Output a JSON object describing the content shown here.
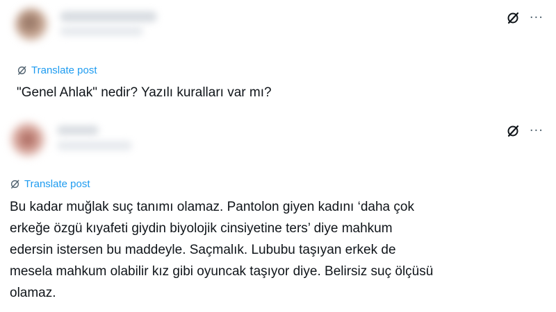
{
  "posts": [
    {
      "avatar_colors": [
        "#8a6a5a",
        "#c9a894"
      ],
      "translate_label": "Translate post",
      "text": "\"Genel Ahlak\" nedir? Yazılı kuralları var mı?",
      "more_label": "···"
    },
    {
      "avatar_colors": [
        "#a05a50",
        "#e8c8c0"
      ],
      "translate_label": "Translate post",
      "text": "Bu kadar muğlak suç tanımı olamaz. Pantolon giyen kadını ‘daha çok\nerkeğe özgü kıyafeti giydin biyolojik cinsiyetine ters’ diye mahkum\nedersin istersen bu maddeyle. Saçmalık. Lububu taşıyan erkek de\nmesela mahkum olabilir kız gibi oyuncak taşıyor diye. Belirsiz suç ölçüsü\nolamaz.",
      "more_label": "···"
    }
  ],
  "colors": {
    "link": "#1d9bf0",
    "text": "#0f1419",
    "muted": "#536471"
  },
  "icons": {
    "grok": "grok-slash-circle-icon",
    "translate": "grok-slash-circle-icon",
    "more": "more-horizontal-icon"
  }
}
